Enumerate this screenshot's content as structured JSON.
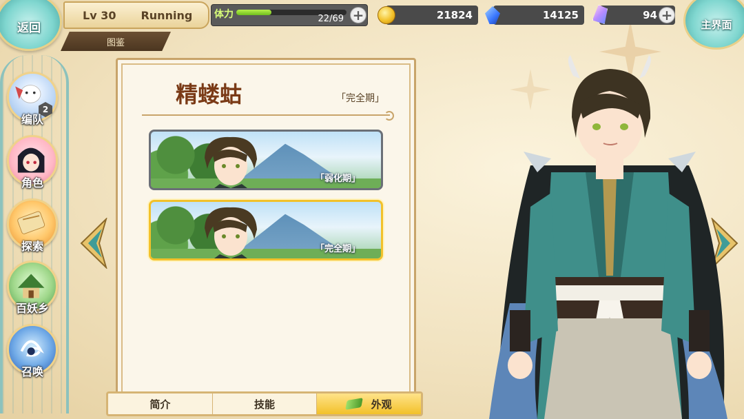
{
  "top_bar": {
    "back_label": "返回",
    "level": "Lv 30",
    "status": "Running",
    "sub_tab": "图鉴",
    "stamina": {
      "label": "体力",
      "current": 22,
      "max": 69,
      "text": "22/69"
    },
    "coins": "21824",
    "gems": "14125",
    "crystals": "94",
    "main_menu_label": "主界面"
  },
  "sidebar": {
    "items": [
      {
        "label": "编队",
        "badge": "2"
      },
      {
        "label": "角色"
      },
      {
        "label": "探索"
      },
      {
        "label": "百妖乡"
      },
      {
        "label": "召唤"
      }
    ]
  },
  "panel": {
    "title": "精蝼蛄",
    "stage": "「完全期」",
    "forms": [
      {
        "label": "「弱化期」",
        "selected": false
      },
      {
        "label": "「完全期」",
        "selected": true
      }
    ]
  },
  "tabs": [
    {
      "label": "简介",
      "active": false
    },
    {
      "label": "技能",
      "active": false
    },
    {
      "label": "外观",
      "active": true
    }
  ],
  "colors": {
    "accent_gold": "#f2c12a",
    "title_brown": "#7a3a16",
    "teal": "#7fd6cf"
  },
  "icons": {
    "coin": "coin-icon",
    "gem": "blue-gem-icon",
    "crystal": "crystal-icon",
    "left": "arrow-left-icon",
    "right": "arrow-right-icon"
  }
}
